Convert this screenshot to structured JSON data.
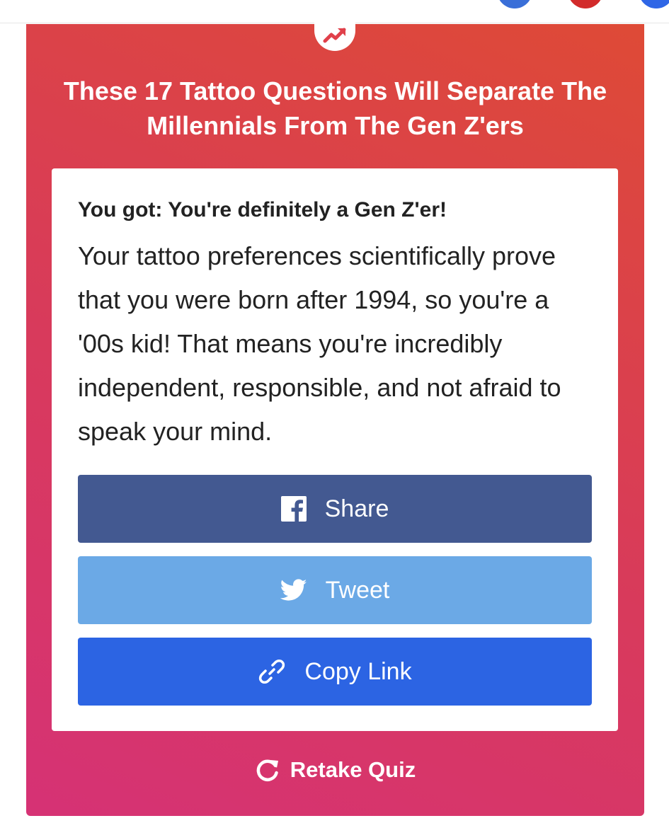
{
  "header": {
    "social_icons": [
      "facebook-icon",
      "pinterest-icon",
      "more-icon"
    ]
  },
  "quiz": {
    "badge_icon": "trending-icon",
    "title": "These 17 Tattoo Questions Will Separate The Millennials From The Gen Z'ers"
  },
  "result": {
    "heading": "You got: You're definitely a Gen Z'er!",
    "description": "Your tattoo preferences scientifically prove that you were born after 1994, so you're a '00s kid! That means you're incredibly independent, responsible, and not afraid to speak your mind."
  },
  "actions": {
    "share_label": "Share",
    "tweet_label": "Tweet",
    "copy_link_label": "Copy Link",
    "retake_label": "Retake Quiz"
  },
  "colors": {
    "facebook": "#435991",
    "twitter": "#6ba9e6",
    "copy_link": "#2c64e3",
    "panel_gradient_start": "#d63275",
    "panel_gradient_end": "#de4a36"
  }
}
